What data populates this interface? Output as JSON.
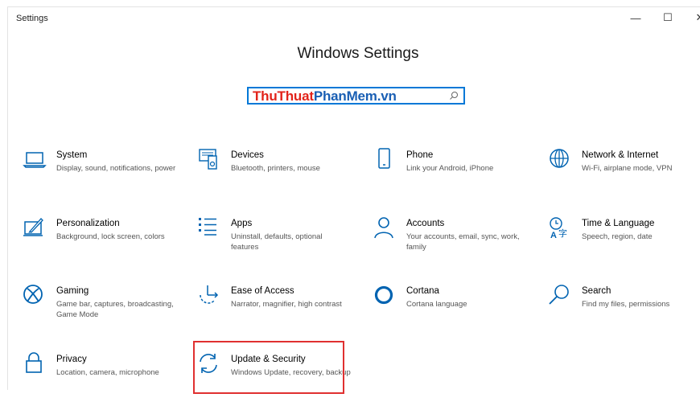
{
  "window": {
    "title": "Settings",
    "minimize": "—",
    "maximize": "☐",
    "close": "✕"
  },
  "page_title": "Windows Settings",
  "search": {
    "watermark_part1": "ThuThuat",
    "watermark_part2": "PhanMem.vn",
    "icon": "search-icon"
  },
  "accent_color": "#0078d7",
  "highlight_color": "#e03030",
  "tiles": [
    {
      "label": "System",
      "desc": "Display, sound, notifications, power",
      "icon": "laptop-icon"
    },
    {
      "label": "Devices",
      "desc": "Bluetooth, printers, mouse",
      "icon": "devices-icon"
    },
    {
      "label": "Phone",
      "desc": "Link your Android, iPhone",
      "icon": "phone-icon"
    },
    {
      "label": "Network & Internet",
      "desc": "Wi-Fi, airplane mode, VPN",
      "icon": "globe-icon"
    },
    {
      "label": "Personalization",
      "desc": "Background, lock screen, colors",
      "icon": "paint-icon"
    },
    {
      "label": "Apps",
      "desc": "Uninstall, defaults, optional features",
      "icon": "apps-list-icon"
    },
    {
      "label": "Accounts",
      "desc": "Your accounts, email, sync, work, family",
      "icon": "person-icon"
    },
    {
      "label": "Time & Language",
      "desc": "Speech, region, date",
      "icon": "time-language-icon"
    },
    {
      "label": "Gaming",
      "desc": "Game bar, captures, broadcasting, Game Mode",
      "icon": "xbox-icon"
    },
    {
      "label": "Ease of Access",
      "desc": "Narrator, magnifier, high contrast",
      "icon": "ease-of-access-icon"
    },
    {
      "label": "Cortana",
      "desc": "Cortana language",
      "icon": "cortana-icon"
    },
    {
      "label": "Search",
      "desc": "Find my files, permissions",
      "icon": "search-icon"
    },
    {
      "label": "Privacy",
      "desc": "Location, camera, microphone",
      "icon": "lock-icon"
    },
    {
      "label": "Update & Security",
      "desc": "Windows Update, recovery, backup",
      "icon": "sync-icon"
    }
  ]
}
